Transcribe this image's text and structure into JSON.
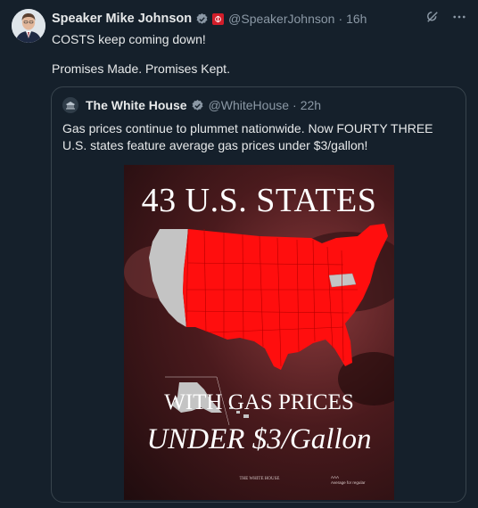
{
  "tweet": {
    "author_name": "Speaker Mike Johnson",
    "handle": "@SpeakerJohnson",
    "separator": "·",
    "time": "16h",
    "line1": "COSTS keep coming down!",
    "line2": "Promises Made. Promises Kept."
  },
  "quote": {
    "author_name": "The White House",
    "handle": "@WhiteHouse",
    "separator": "·",
    "time": "22h",
    "text": "Gas prices continue to plummet nationwide. Now FOURTY THREE U.S. states feature average gas prices under $3/gallon!"
  },
  "poster": {
    "title": "43 U.S. STATES",
    "subtitle": "WITH GAS PRICES",
    "price": "UNDER $3/Gallon",
    "footer_left": "THE WHITE HOUSE",
    "footer_right_1": "AAA",
    "footer_right_2": "Average for regular"
  },
  "colors": {
    "background": "#15202b",
    "text": "#e7e9ea",
    "muted": "#8b98a5",
    "border": "#38444d",
    "map_red": "#ff0e0e",
    "map_grey": "#c4c4c4",
    "verified_blue": "#1d9bf0"
  },
  "icons": [
    "verified-badge-icon",
    "flag-badge-icon",
    "grok-icon",
    "more-icon",
    "white-house-icon",
    "us-map"
  ]
}
